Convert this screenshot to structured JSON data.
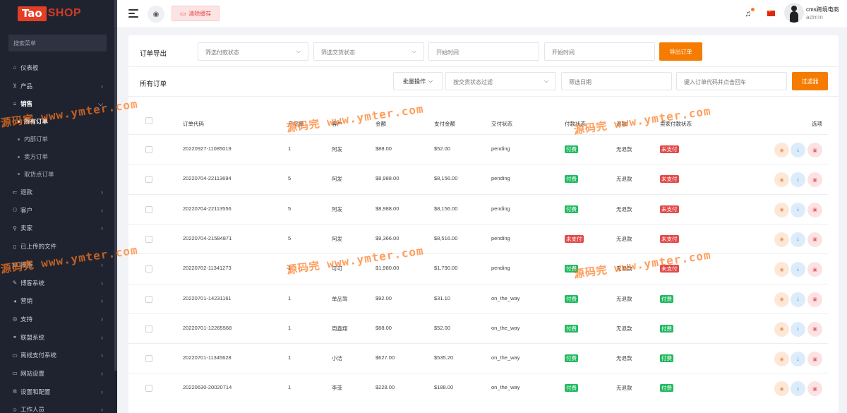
{
  "sidebar": {
    "logo": {
      "tao": "Tao",
      "shop": "SHOP"
    },
    "search_placeholder": "搜索菜单",
    "items": [
      {
        "label": "仪表板",
        "icon": "home-icon",
        "has_children": false
      },
      {
        "label": "产品",
        "icon": "cart-icon",
        "has_children": true
      },
      {
        "label": "销售",
        "icon": "list-icon",
        "has_children": true,
        "expanded": true,
        "children": [
          {
            "label": "所有订单",
            "active": true
          },
          {
            "label": "内部订单"
          },
          {
            "label": "卖方订单"
          },
          {
            "label": "取货点订单"
          }
        ]
      },
      {
        "label": "退款",
        "icon": "refund-icon",
        "has_children": true
      },
      {
        "label": "客户",
        "icon": "users-icon",
        "has_children": true
      },
      {
        "label": "卖家",
        "icon": "user-icon",
        "has_children": true
      },
      {
        "label": "已上传的文件",
        "icon": "file-icon",
        "has_children": false
      },
      {
        "label": "报告",
        "icon": "chart-icon",
        "has_children": true
      },
      {
        "label": "博客系统",
        "icon": "blog-icon",
        "has_children": true
      },
      {
        "label": "营销",
        "icon": "megaphone-icon",
        "has_children": true
      },
      {
        "label": "支持",
        "icon": "support-icon",
        "has_children": true
      },
      {
        "label": "联盟系统",
        "icon": "affiliate-icon",
        "has_children": true
      },
      {
        "label": "离线支付系统",
        "icon": "wallet-icon",
        "has_children": true
      },
      {
        "label": "网站设置",
        "icon": "monitor-icon",
        "has_children": true
      },
      {
        "label": "设置和配置",
        "icon": "gear-icon",
        "has_children": true
      },
      {
        "label": "工作人员",
        "icon": "staff-icon",
        "has_children": true
      }
    ]
  },
  "topbar": {
    "clear_cache": "清除缓存",
    "user_name": "cms跨境电商",
    "user_role": "admin",
    "colors": {
      "flag": "#de2910",
      "notify_dot": "#ff7a22"
    }
  },
  "export": {
    "title": "订单导出",
    "payment_status_placeholder": "筛选付款状态",
    "delivery_status_placeholder": "筛选交货状态",
    "start_time_placeholder": "开始时间",
    "end_time_placeholder": "开始时间",
    "export_button": "导出订单"
  },
  "orders": {
    "title": "所有订单",
    "bulk_action": "批量操作",
    "delivery_filter_placeholder": "按交货状态过滤",
    "date_filter_placeholder": "筛选日期",
    "code_search_placeholder": "键入订单代码并点击回车",
    "filter_button": "过滤器",
    "columns": [
      "订单代码",
      "产品量",
      "客户",
      "金额",
      "支付金额",
      "交付状态",
      "付款状态",
      "退款",
      "卖家付款状态",
      "选项"
    ],
    "rows": [
      {
        "code": "20220927-11085019",
        "qty": "1",
        "customer": "阿发",
        "amount": "$88.00",
        "paid": "$52.00",
        "delivery": "pending",
        "payment": "付费",
        "payment_color": "green",
        "refund": "无退款",
        "seller_payment": "未支付",
        "seller_color": "red"
      },
      {
        "code": "20220704-22113694",
        "qty": "5",
        "customer": "阿发",
        "amount": "$8,988.00",
        "paid": "$8,156.00",
        "delivery": "pending",
        "payment": "付费",
        "payment_color": "green",
        "refund": "无退款",
        "seller_payment": "未支付",
        "seller_color": "red"
      },
      {
        "code": "20220704-22113556",
        "qty": "5",
        "customer": "阿发",
        "amount": "$8,988.00",
        "paid": "$8,156.00",
        "delivery": "pending",
        "payment": "付费",
        "payment_color": "green",
        "refund": "无退款",
        "seller_payment": "未支付",
        "seller_color": "red"
      },
      {
        "code": "20220704-21584871",
        "qty": "5",
        "customer": "阿发",
        "amount": "$9,366.00",
        "paid": "$8,516.00",
        "delivery": "pending",
        "payment": "未支付",
        "payment_color": "red",
        "refund": "无退款",
        "seller_payment": "未支付",
        "seller_color": "red"
      },
      {
        "code": "20220702-11341273",
        "qty": "1",
        "customer": "可可",
        "amount": "$1,980.00",
        "paid": "$1,790.00",
        "delivery": "pending",
        "payment": "付费",
        "payment_color": "green",
        "refund": "无退款",
        "seller_payment": "未支付",
        "seller_color": "red"
      },
      {
        "code": "20220701-14231161",
        "qty": "1",
        "customer": "单品驾",
        "amount": "$92.00",
        "paid": "$31.10",
        "delivery": "on_the_way",
        "payment": "付费",
        "payment_color": "green",
        "refund": "无退款",
        "seller_payment": "付费",
        "seller_color": "green"
      },
      {
        "code": "20220701-12265568",
        "qty": "1",
        "customer": "周鑫翔",
        "amount": "$88.00",
        "paid": "$52.00",
        "delivery": "on_the_way",
        "payment": "付费",
        "payment_color": "green",
        "refund": "无退款",
        "seller_payment": "付费",
        "seller_color": "green"
      },
      {
        "code": "20220701-11345628",
        "qty": "1",
        "customer": "小洁",
        "amount": "$627.00",
        "paid": "$535.20",
        "delivery": "on_the_way",
        "payment": "付费",
        "payment_color": "green",
        "refund": "无退款",
        "seller_payment": "付费",
        "seller_color": "green"
      },
      {
        "code": "20220630-20020714",
        "qty": "1",
        "customer": "李菲",
        "amount": "$228.00",
        "paid": "$188.00",
        "delivery": "on_the_way",
        "payment": "付费",
        "payment_color": "green",
        "refund": "无退款",
        "seller_payment": "付费",
        "seller_color": "green"
      }
    ]
  },
  "watermark": {
    "cn": "源码完",
    "url": "www.ymter.com"
  },
  "colors": {
    "accent": "#f57c00",
    "sidebar_bg": "#1f2330",
    "paid_green": "#22b95f",
    "unpaid_red": "#e34a4a"
  }
}
